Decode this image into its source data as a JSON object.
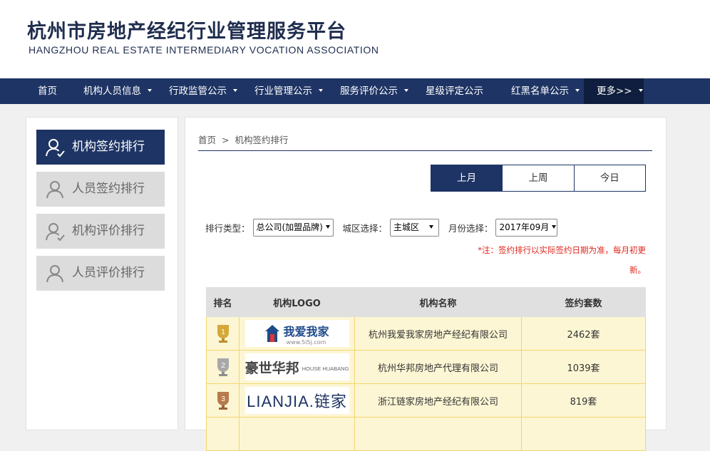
{
  "header": {
    "title": "杭州市房地产经纪行业管理服务平台",
    "subtitle": "HANGZHOU REAL ESTATE INTERMEDIARY VOCATION ASSOCIATION"
  },
  "nav": {
    "items": [
      {
        "label": "首页",
        "dropdown": false
      },
      {
        "label": "机构人员信息",
        "dropdown": true
      },
      {
        "label": "行政监管公示",
        "dropdown": true
      },
      {
        "label": "行业管理公示",
        "dropdown": true
      },
      {
        "label": "服务评价公示",
        "dropdown": true
      },
      {
        "label": "星级评定公示",
        "dropdown": false
      },
      {
        "label": "红黑名单公示",
        "dropdown": true
      },
      {
        "label": "更多>>",
        "dropdown": true
      }
    ]
  },
  "sidebar": {
    "items": [
      {
        "label": "机构签约排行",
        "active": true,
        "icon": "user-check-icon"
      },
      {
        "label": "人员签约排行",
        "active": false,
        "icon": "user-icon"
      },
      {
        "label": "机构评价排行",
        "active": false,
        "icon": "user-check-icon"
      },
      {
        "label": "人员评价排行",
        "active": false,
        "icon": "user-icon"
      }
    ]
  },
  "breadcrumb": {
    "home": "首页",
    "separator": ">",
    "current": "机构签约排行"
  },
  "tabs": [
    {
      "label": "上月",
      "active": true
    },
    {
      "label": "上周",
      "active": false
    },
    {
      "label": "今日",
      "active": false
    }
  ],
  "filters": {
    "type_label": "排行类型：",
    "type_value": "总公司(加盟品牌)",
    "area_label": "城区选择：",
    "area_value": "主城区",
    "month_label": "月份选择：",
    "month_value": "2017年09月"
  },
  "note": {
    "line1": "*注：签约排行以实际签约日期为准，每月初更",
    "line2": "新。"
  },
  "table": {
    "headers": [
      "排名",
      "机构LOGO",
      "机构名称",
      "签约套数"
    ],
    "rows": [
      {
        "rank": "1",
        "medal": "gold",
        "logo": "我爱我家",
        "logo_sub": "www.5i5j.com",
        "name": "杭州我爱我家房地产经纪有限公司",
        "count": "2462套"
      },
      {
        "rank": "2",
        "medal": "silver",
        "logo": "豪世华邦",
        "logo_sub": "HOUSE HUABANG",
        "name": "杭州华邦房地产代理有限公司",
        "count": "1039套"
      },
      {
        "rank": "3",
        "medal": "bronze",
        "logo": "LIANJIA.链家",
        "logo_sub": "",
        "name": "浙江链家房地产经纪有限公司",
        "count": "819套"
      }
    ]
  },
  "colors": {
    "primary": "#1e3464",
    "note_red": "#e0251d",
    "row_bg": "#fdf6d4",
    "gold": "#d4a93a",
    "silver": "#a8a8a8",
    "bronze": "#b87a4b"
  }
}
